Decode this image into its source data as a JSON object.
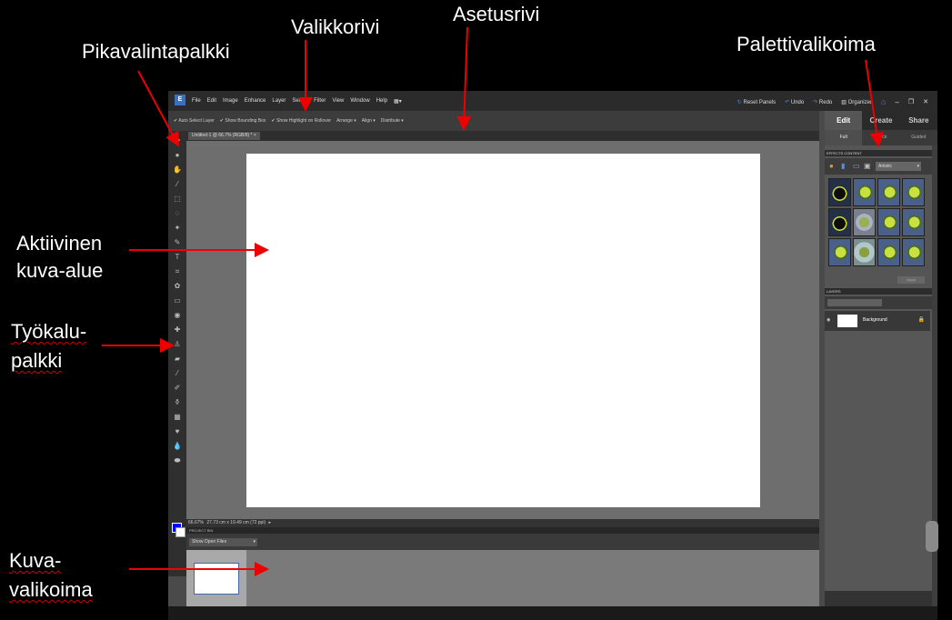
{
  "annotations": {
    "pikavalintapalkki": "Pikavalintapalkki",
    "valikkorivi": "Valikkorivi",
    "asetusrivi": "Asetusrivi",
    "palettivalikoima": "Palettivalikoima",
    "aktiivinen_1": "Aktiivinen",
    "aktiivinen_2": "kuva-alue",
    "tyokalu_1": "Työkalu-",
    "tyokalu_2": "palkki",
    "kuva_1": "Kuva-",
    "kuva_2": "valikoima"
  },
  "app": {
    "logo": "E",
    "menu": [
      "File",
      "Edit",
      "Image",
      "Enhance",
      "Layer",
      "Select",
      "Filter",
      "View",
      "Window",
      "Help"
    ],
    "right": {
      "reset": "Reset Panels",
      "undo": "Undo",
      "redo": "Redo",
      "organizer": "Organizer"
    },
    "options": [
      "Auto Select Layer",
      "Show Bounding Box",
      "Show Highlight on Rollover",
      "Arrange ▾",
      "Align ▾",
      "Distribute ▾"
    ],
    "doc_tab": "Untitled-1 @ 66.7% (RGB/8) *",
    "status": {
      "zoom": "66.67%",
      "size": "27.73 cm x 19.49 cm (72 ppi)"
    },
    "project_bin": {
      "title": "PROJECT BIN",
      "dropdown": "Show Open Files"
    },
    "right_panel": {
      "tabs": [
        "Edit",
        "Create",
        "Share"
      ],
      "subtabs": [
        "Full",
        "Quick",
        "Guided"
      ],
      "effects_header": "EFFECTS  CONTENT",
      "effects_dropdown": "Artistic",
      "apply": "Apply",
      "layers_header": "LAYERS",
      "layer_name": "Background",
      "lock_icon": "lock-icon"
    }
  }
}
